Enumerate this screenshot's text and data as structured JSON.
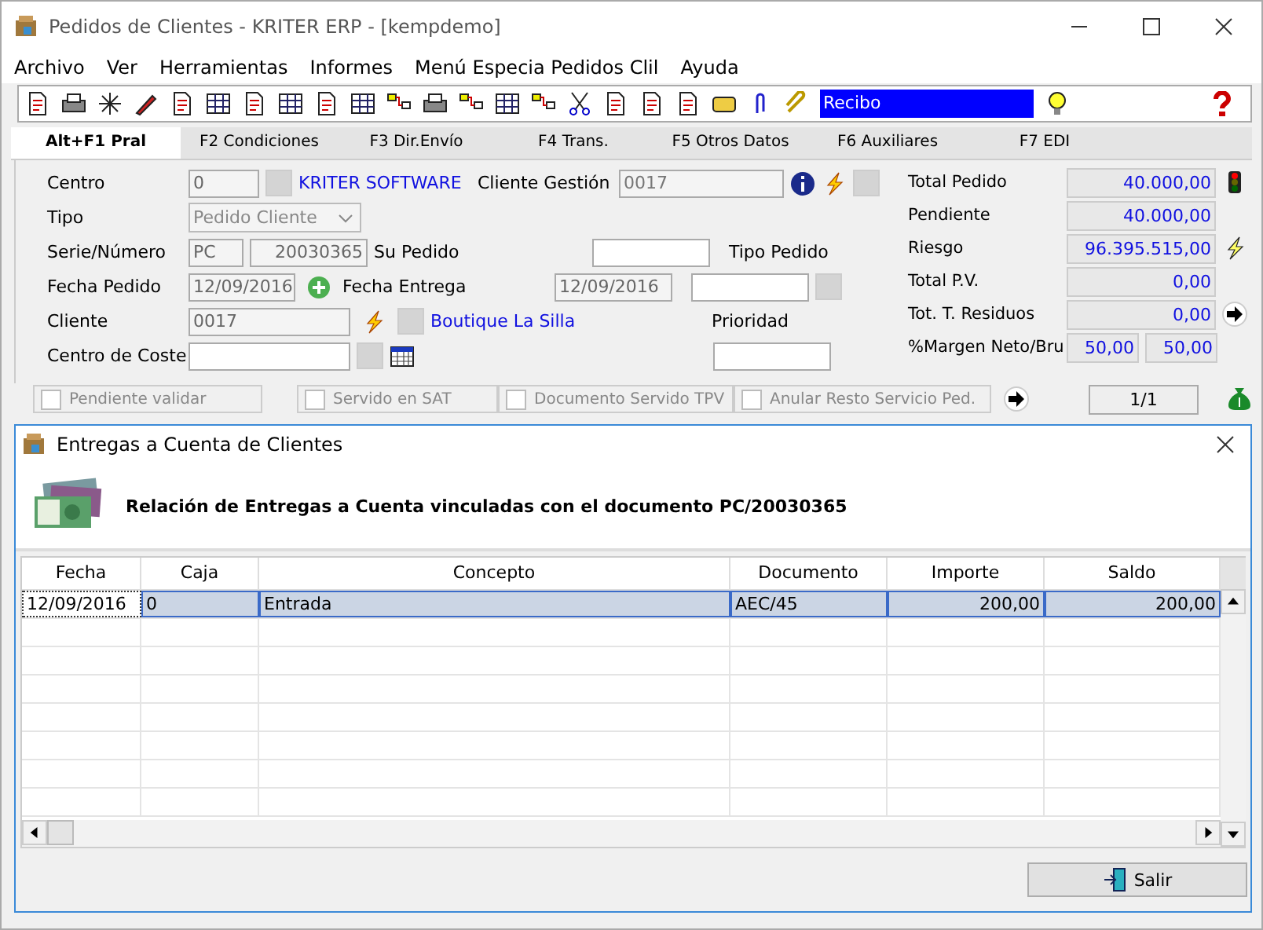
{
  "window": {
    "title": "Pedidos de Clientes - KRITER ERP - [kempdemo]"
  },
  "menu": [
    "Archivo",
    "Ver",
    "Herramientas",
    "Informes",
    "Menú Especia Pedidos Clil",
    "Ayuda"
  ],
  "toolbar": {
    "report_field": "Recibo"
  },
  "tabs": [
    {
      "label": "Alt+F1 Pral",
      "selected": true
    },
    {
      "label": "F2 Condiciones",
      "selected": false
    },
    {
      "label": "F3 Dir.Envío",
      "selected": false
    },
    {
      "label": "F4 Trans.",
      "selected": false
    },
    {
      "label": "F5 Otros Datos",
      "selected": false
    },
    {
      "label": "F6 Auxiliares",
      "selected": false
    },
    {
      "label": "F7 EDI",
      "selected": false
    }
  ],
  "form": {
    "centro": {
      "label": "Centro",
      "value": "0",
      "name": "KRITER SOFTWARE"
    },
    "cliente_gestion": {
      "label": "Cliente Gestión",
      "value": "0017"
    },
    "tipo": {
      "label": "Tipo",
      "value": "Pedido Cliente"
    },
    "serie": {
      "label": "Serie/Número",
      "serie": "PC",
      "numero": "20030365"
    },
    "su_pedido": {
      "label": "Su Pedido"
    },
    "tipo_pedido": {
      "label": "Tipo Pedido"
    },
    "fecha_pedido": {
      "label": "Fecha Pedido",
      "value": "12/09/2016"
    },
    "fecha_entrega": {
      "label": "Fecha Entrega",
      "value": "12/09/2016"
    },
    "cliente": {
      "label": "Cliente",
      "value": "0017",
      "name": "Boutique La Silla"
    },
    "prioridad": {
      "label": "Prioridad"
    },
    "centro_coste": {
      "label": "Centro de Coste"
    }
  },
  "totals": [
    {
      "label": "Total Pedido",
      "value": "40.000,00"
    },
    {
      "label": "Pendiente",
      "value": "40.000,00"
    },
    {
      "label": "Riesgo",
      "value": "96.395.515,00"
    },
    {
      "label": "Total P.V.",
      "value": "0,00"
    },
    {
      "label": "Tot. T. Residuos",
      "value": "0,00"
    }
  ],
  "margin": {
    "label": "%Margen Neto/Bru",
    "values": [
      "50,00",
      "50,00"
    ]
  },
  "flags": [
    {
      "label": "Pendiente validar",
      "checked": false
    },
    {
      "label": "Servido en SAT",
      "checked": false
    },
    {
      "label": "Documento Servido TPV",
      "checked": false
    },
    {
      "label": "Anular Resto Servicio Ped.",
      "checked": false
    }
  ],
  "pager": "1/1",
  "dialog": {
    "title": "Entregas a Cuenta de Clientes",
    "heading": "Relación de Entregas a Cuenta vinculadas con el documento PC/20030365",
    "table": {
      "columns": [
        "Fecha",
        "Caja",
        "Concepto",
        "Documento",
        "Importe",
        "Saldo"
      ],
      "rows": [
        {
          "cells": [
            "12/09/2016",
            "0",
            "Entrada",
            "AEC/45",
            "200,00",
            "200,00"
          ],
          "selected": true
        }
      ]
    },
    "button": "Salir"
  }
}
